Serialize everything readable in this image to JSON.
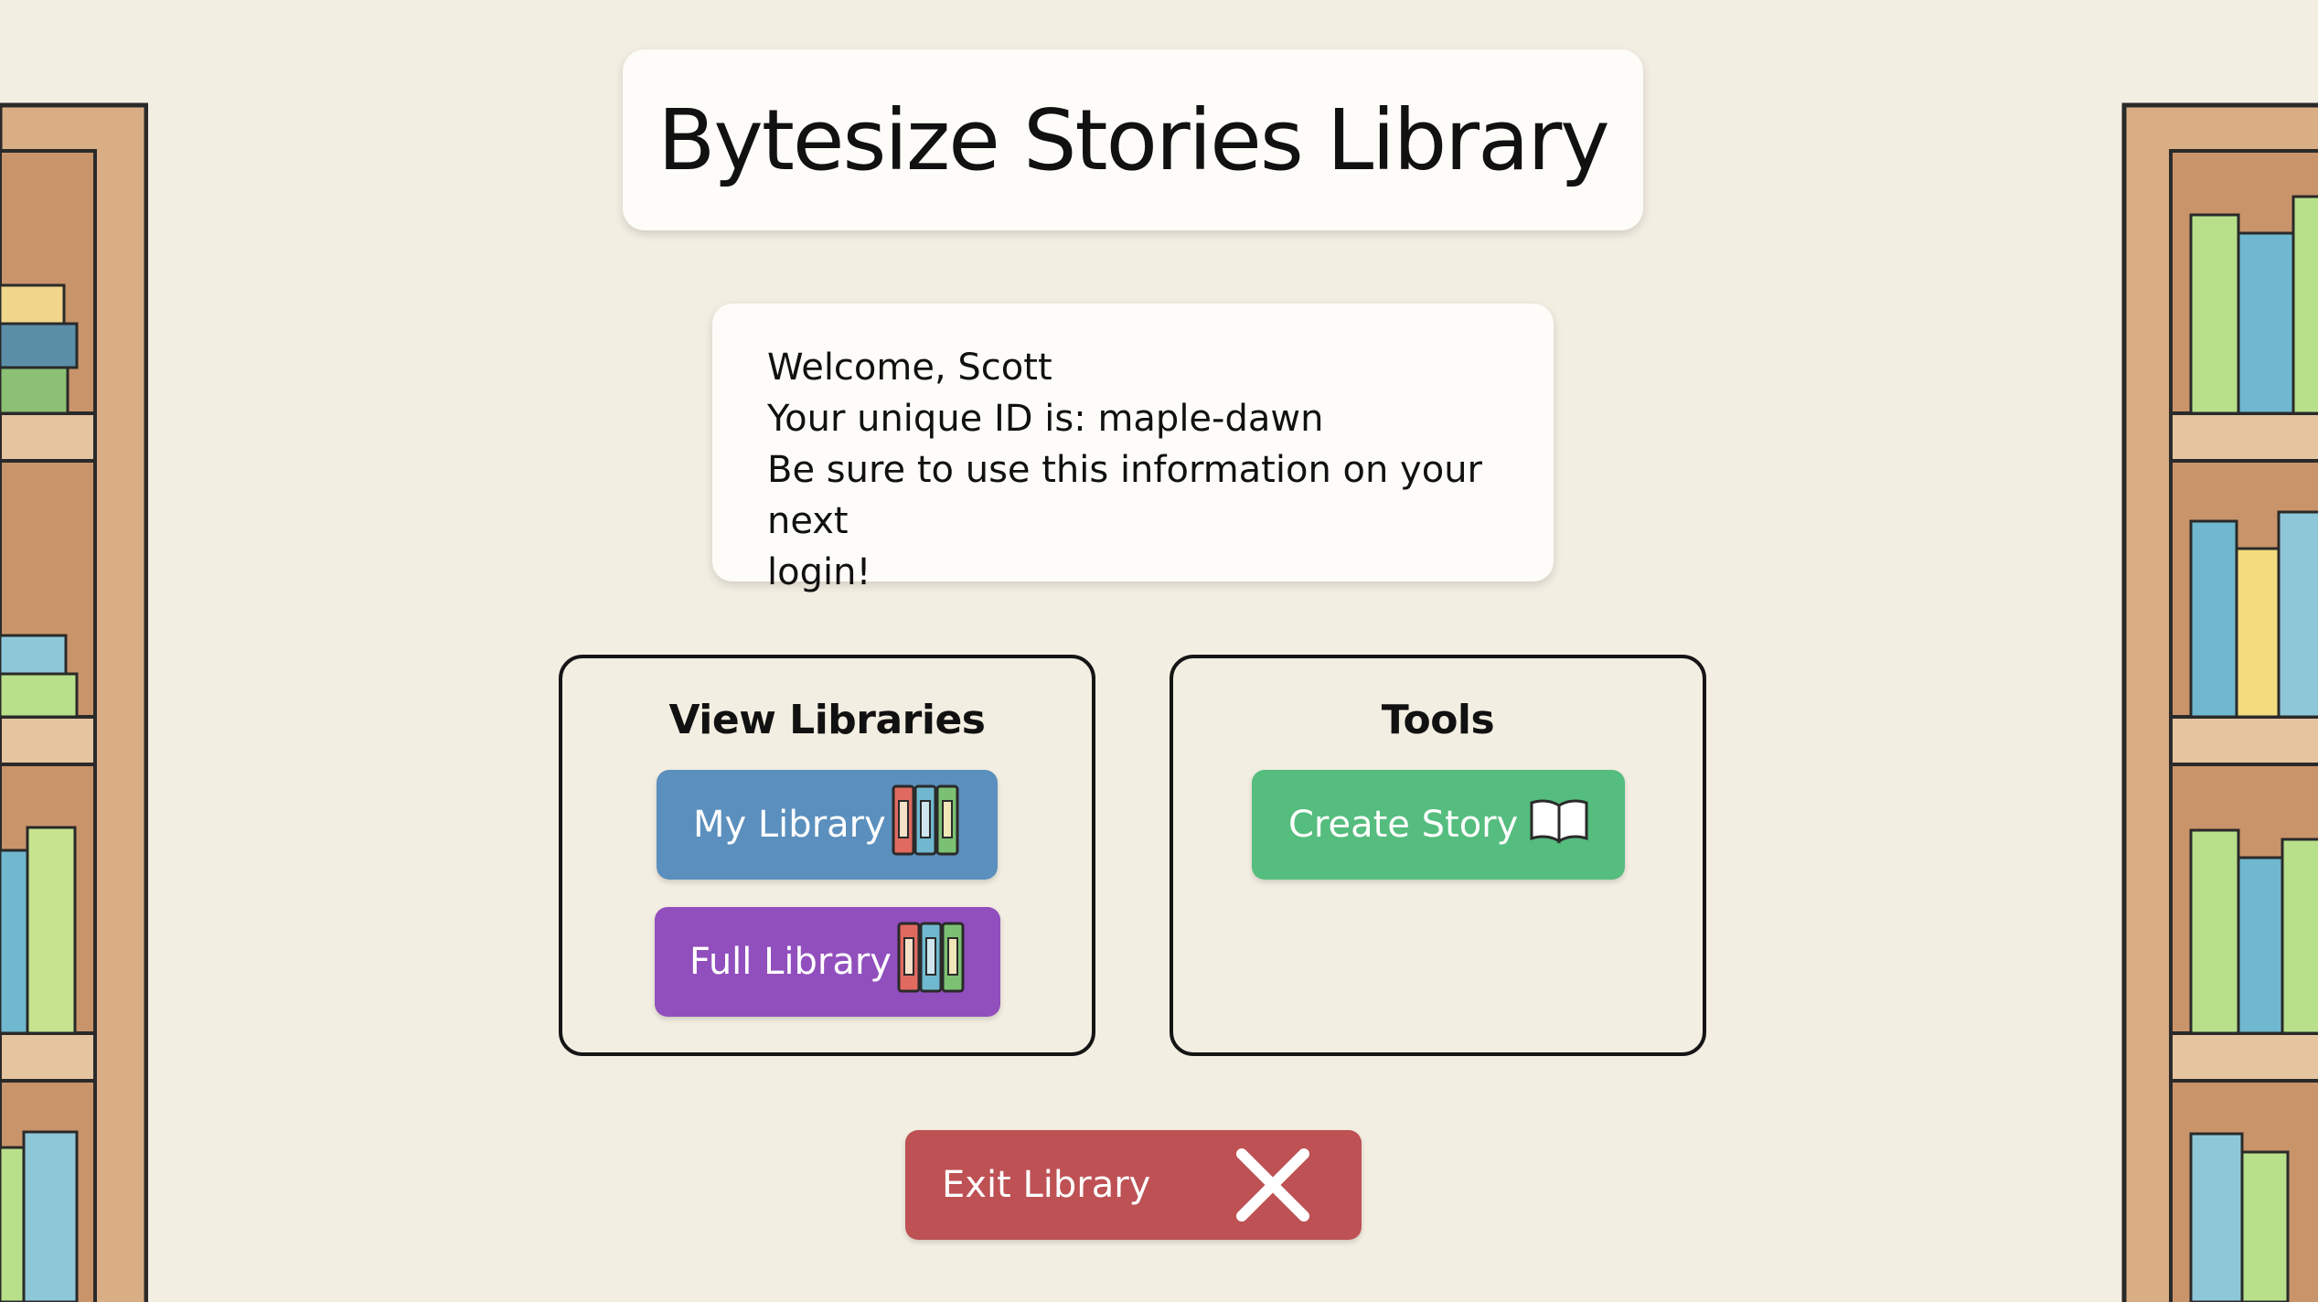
{
  "header": {
    "title": "Bytesize Stories Library"
  },
  "welcome": {
    "greeting": "Welcome, Scott",
    "id_line": "Your unique ID is: maple-dawn",
    "reminder_line1": "Be sure to use this information on your next",
    "reminder_line2": "login!"
  },
  "libraries_panel": {
    "heading": "View Libraries",
    "my_library_label": "My Library",
    "full_library_label": "Full Library",
    "icon": "books-icon"
  },
  "tools_panel": {
    "heading": "Tools",
    "create_story_label": "Create Story",
    "icon": "open-book-icon"
  },
  "exit": {
    "label": "Exit Library",
    "icon": "close-icon"
  },
  "colors": {
    "background": "#f3eee2",
    "my_library": "#5b8fbd",
    "full_library": "#914fbd",
    "create_story": "#55bd7e",
    "exit": "#bd5154"
  }
}
